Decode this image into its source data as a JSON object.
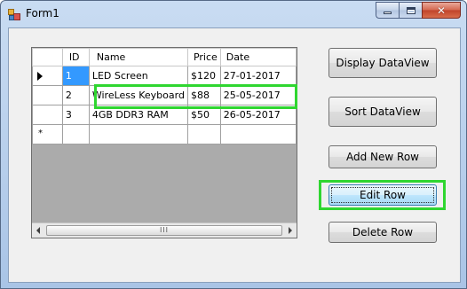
{
  "window": {
    "title": "Form1"
  },
  "grid": {
    "columns": [
      "ID",
      "Name",
      "Price",
      "Date"
    ],
    "rows": [
      {
        "id": "1",
        "name": "LED Screen",
        "price": "$120",
        "date": "27-01-2017",
        "current": true,
        "selected_cell": "id"
      },
      {
        "id": "2",
        "name": "WireLess Keyboard",
        "price": "$88",
        "date": "25-05-2017",
        "highlighted": true
      },
      {
        "id": "3",
        "name": "4GB DDR3 RAM",
        "price": "$50",
        "date": "26-05-2017"
      }
    ],
    "new_row_marker": "*",
    "scroll_grip": "III"
  },
  "buttons": {
    "display_dataview": "Display DataView",
    "sort_dataview": "Sort DataView",
    "add_new_row": "Add New Row",
    "edit_row": "Edit Row",
    "delete_row": "Delete Row"
  },
  "colors": {
    "highlight": "#2fd630",
    "selection": "#3399ff",
    "grid_background": "#ababab"
  },
  "icons": {
    "app": "form-app-icon",
    "minimize": "minimize-icon",
    "maximize": "maximize-icon",
    "close": "close-icon"
  }
}
